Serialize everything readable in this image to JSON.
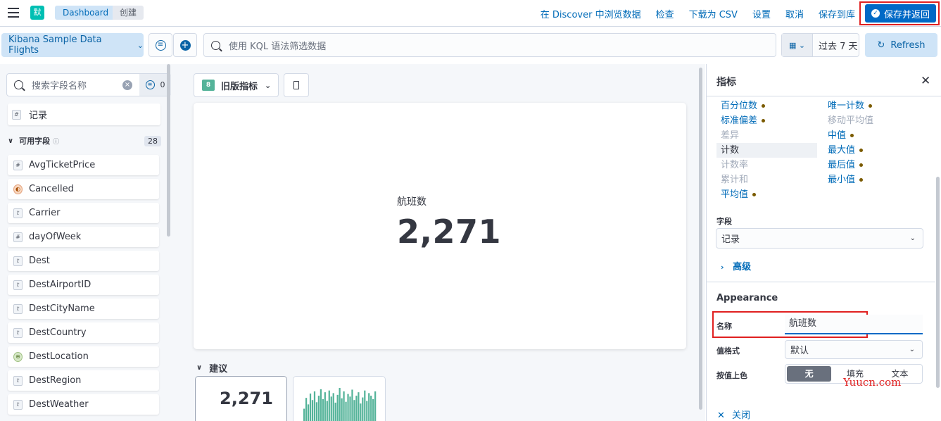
{
  "header": {
    "app_icon_text": "默",
    "breadcrumbs": [
      "Dashboard",
      "创建"
    ],
    "links": [
      "在 Discover 中浏览数据",
      "检查",
      "下载为 CSV",
      "设置",
      "取消",
      "保存到库"
    ],
    "save_return_label": "保存并返回"
  },
  "query_bar": {
    "data_view": "Kibana Sample Data Flights",
    "search_placeholder": "使用 KQL 语法筛选数据",
    "time_range": "过去 7 天",
    "refresh_label": "Refresh"
  },
  "field_panel": {
    "search_placeholder": "搜索字段名称",
    "filter_count": "0",
    "record_label": "记录",
    "group_label": "可用字段",
    "group_count": "28",
    "fields": [
      {
        "name": "AvgTicketPrice",
        "type": "number",
        "token": "#"
      },
      {
        "name": "Cancelled",
        "type": "boolean",
        "token": "◐"
      },
      {
        "name": "Carrier",
        "type": "keyword",
        "token": "t"
      },
      {
        "name": "dayOfWeek",
        "type": "number",
        "token": "#"
      },
      {
        "name": "Dest",
        "type": "keyword",
        "token": "t"
      },
      {
        "name": "DestAirportID",
        "type": "keyword",
        "token": "t"
      },
      {
        "name": "DestCityName",
        "type": "keyword",
        "token": "t"
      },
      {
        "name": "DestCountry",
        "type": "keyword",
        "token": "t"
      },
      {
        "name": "DestLocation",
        "type": "geo",
        "token": "⊕"
      },
      {
        "name": "DestRegion",
        "type": "keyword",
        "token": "t"
      },
      {
        "name": "DestWeather",
        "type": "keyword",
        "token": "t"
      }
    ]
  },
  "workspace": {
    "chart_type_badge": "8",
    "chart_type_label": "旧版指标",
    "metric_label": "航班数",
    "metric_value": "2,271",
    "suggestions_label": "建议",
    "suggestion_value": "2,271",
    "suggestion_bars": [
      30,
      55,
      40,
      65,
      50,
      70,
      45,
      60,
      75,
      52,
      68,
      48,
      72,
      58,
      66,
      44,
      62,
      78,
      54,
      70,
      46,
      64,
      58,
      74,
      50,
      60,
      68,
      42,
      56,
      72,
      48,
      66,
      60,
      52,
      70
    ]
  },
  "flyout": {
    "title": "指标",
    "functions_left": [
      {
        "label": "百分位数",
        "state": "enabled",
        "dot": true
      },
      {
        "label": "标准偏差",
        "state": "enabled",
        "dot": true
      },
      {
        "label": "差异",
        "state": "disabled",
        "dot": false
      },
      {
        "label": "计数",
        "state": "selected",
        "dot": false
      },
      {
        "label": "计数率",
        "state": "disabled",
        "dot": false
      },
      {
        "label": "累计和",
        "state": "disabled",
        "dot": false
      },
      {
        "label": "平均值",
        "state": "enabled",
        "dot": true
      }
    ],
    "functions_right": [
      {
        "label": "唯一计数",
        "state": "enabled",
        "dot": true
      },
      {
        "label": "移动平均值",
        "state": "disabled",
        "dot": false
      },
      {
        "label": "中值",
        "state": "enabled",
        "dot": true
      },
      {
        "label": "最大值",
        "state": "enabled",
        "dot": true
      },
      {
        "label": "最后值",
        "state": "enabled",
        "dot": true
      },
      {
        "label": "最小值",
        "state": "enabled",
        "dot": true
      }
    ],
    "field_label": "字段",
    "field_value": "记录",
    "advanced_label": "高级",
    "appearance_title": "Appearance",
    "name_label": "名称",
    "name_value": "航班数",
    "value_format_label": "值格式",
    "value_format_value": "默认",
    "color_label": "按值上色",
    "color_options": [
      "无",
      "填充",
      "文本"
    ],
    "close_label": "关闭"
  },
  "watermark": "Yuucn.com",
  "colors": {
    "primary": "#0069c6",
    "link": "#006bb8",
    "highlight_outline": "#e02020",
    "metric_green": "#54b399"
  }
}
